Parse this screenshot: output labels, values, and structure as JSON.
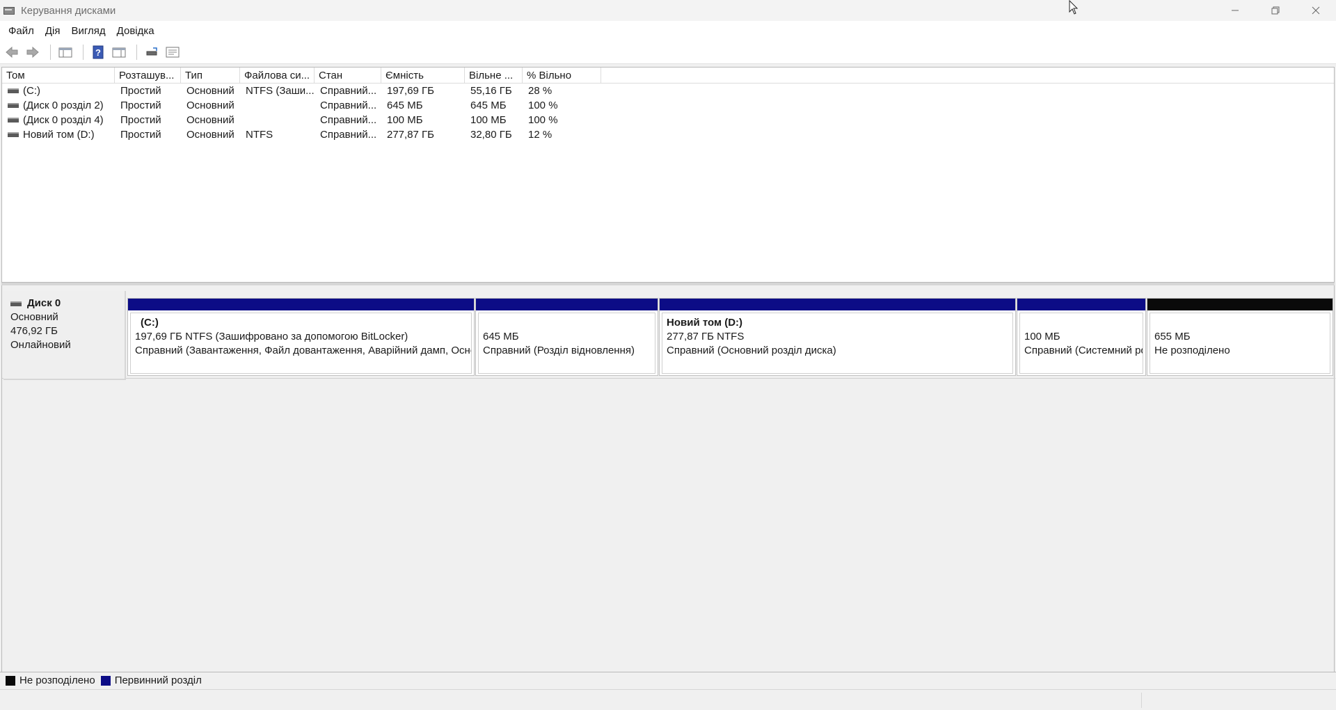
{
  "window": {
    "title": "Керування дисками"
  },
  "menu": [
    "Файл",
    "Дія",
    "Вигляд",
    "Довідка"
  ],
  "toolbar": [
    "back-icon",
    "forward-icon",
    "console-tree-icon",
    "help-icon",
    "action-pane-icon",
    "rescan-icon",
    "properties-icon"
  ],
  "volume_list": {
    "columns": [
      "Том",
      "Розташув...",
      "Тип",
      "Файлова си...",
      "Стан",
      "Ємність",
      "Вільне ...",
      "% Вільно"
    ],
    "rows": [
      [
        "(C:)",
        "Простий",
        "Основний",
        "NTFS (Заши...",
        "Справний...",
        "197,69 ГБ",
        "55,16 ГБ",
        "28 %"
      ],
      [
        "(Диск 0 розділ 2)",
        "Простий",
        "Основний",
        "",
        "Справний...",
        "645 МБ",
        "645 МБ",
        "100 %"
      ],
      [
        "(Диск 0 розділ 4)",
        "Простий",
        "Основний",
        "",
        "Справний...",
        "100 МБ",
        "100 МБ",
        "100 %"
      ],
      [
        "Новий том (D:)",
        "Простий",
        "Основний",
        "NTFS",
        "Справний...",
        "277,87 ГБ",
        "32,80 ГБ",
        "12 %"
      ]
    ]
  },
  "disk": {
    "name": "Диск 0",
    "type": "Основний",
    "size": "476,92 ГБ",
    "status": "Онлайновий",
    "partitions": [
      {
        "title": "(C:)",
        "line1": "197,69 ГБ NTFS (Зашифровано за допомогою BitLocker)",
        "line2": "Справний (Завантаження, Файл довантаження, Аварійний дамп, Основний розділ диска)",
        "kind": "primary"
      },
      {
        "title": "",
        "line1": "645 МБ",
        "line2": "Справний (Розділ відновлення)",
        "kind": "primary"
      },
      {
        "title": "Новий том  (D:)",
        "line1": "277,87 ГБ NTFS",
        "line2": "Справний (Основний розділ диска)",
        "kind": "primary"
      },
      {
        "title": "",
        "line1": "100 МБ",
        "line2": "Справний (Системний розділ EFI)",
        "kind": "primary"
      },
      {
        "title": "",
        "line1": "655 МБ",
        "line2": "Не розподілено",
        "kind": "unallocated"
      }
    ]
  },
  "legend": [
    {
      "label": "Не розподілено",
      "color": "#0a0a0a"
    },
    {
      "label": "Первинний розділ",
      "color": "#0c0c86"
    }
  ]
}
